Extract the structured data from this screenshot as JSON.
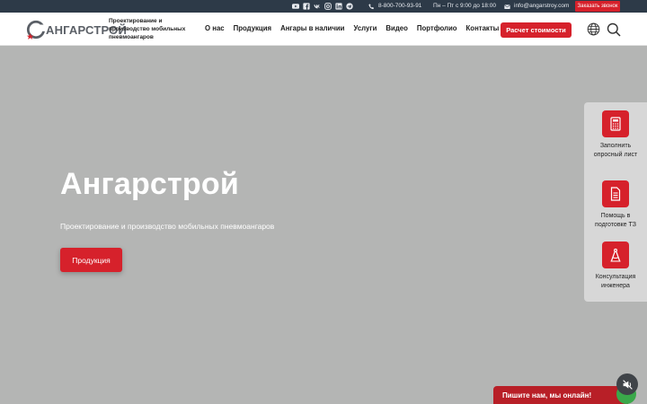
{
  "topbar": {
    "social_icons": [
      "youtube-icon",
      "facebook-icon",
      "vk-icon",
      "instagram-icon",
      "linkedin-icon",
      "telegram-icon"
    ],
    "phone": "8-800-700-93-91",
    "hours": "Пн – Пт с 9:00 до 18:00",
    "email": "info@angarstroy.com",
    "callback_label": "Заказать звонок"
  },
  "header": {
    "logo_text": "АНГАРСТРОЙ",
    "tagline": "Проектирование и производство мобильных пневмоангаров",
    "nav": [
      "О нас",
      "Продукция",
      "Ангары в наличии",
      "Услуги",
      "Видео",
      "Портфолио",
      "Контакты"
    ],
    "calc_button": "Расчет стоимости"
  },
  "hero": {
    "title": "Ангарстрой",
    "subtitle": "Проектирование и производство мобильных пневмоангаров",
    "button": "Продукция"
  },
  "side_panel": {
    "items": [
      {
        "label": "Заполнить опросный лист",
        "icon": "calculator-icon"
      },
      {
        "label": "Помощь в подготовке ТЗ",
        "icon": "document-icon"
      },
      {
        "label": "Консультация инженера",
        "icon": "compass-icon"
      }
    ]
  },
  "chat": {
    "label": "Пишите нам, мы онлайн!"
  },
  "colors": {
    "accent": "#d6212b",
    "topbar": "#2d3a48",
    "hero_bg": "#b4b5b4"
  }
}
